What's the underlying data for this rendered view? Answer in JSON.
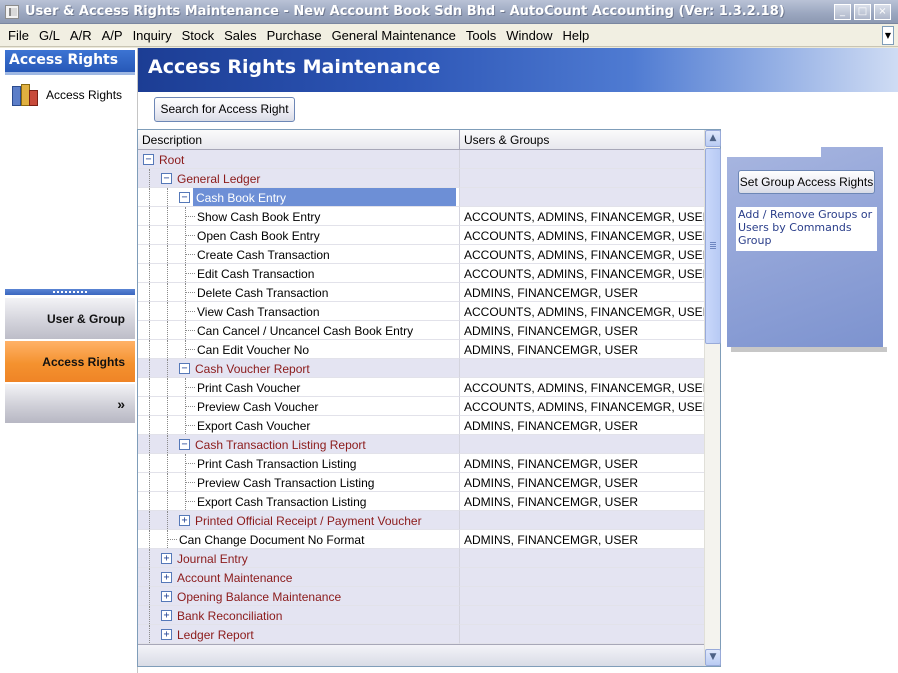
{
  "window": {
    "title": "User & Access Rights Maintenance - New Account Book Sdn Bhd - AutoCount Accounting (Ver: 1.3.2.18)",
    "min_glyph": "_",
    "max_glyph": "□",
    "close_glyph": "×"
  },
  "menu": [
    "File",
    "G/L",
    "A/R",
    "A/P",
    "Inquiry",
    "Stock",
    "Sales",
    "Purchase",
    "General Maintenance",
    "Tools",
    "Window",
    "Help"
  ],
  "leftnav": {
    "header": "Access Rights",
    "item_label": "Access Rights",
    "user_group_button": "User & Group",
    "access_rights_button": "Access Rights",
    "more_button": "»"
  },
  "header": {
    "title": "Access Rights Maintenance"
  },
  "search_button": "Search for Access Right",
  "tree": {
    "col_description": "Description",
    "col_users": "Users & Groups",
    "rows": [
      {
        "label": "Root",
        "users": "",
        "group": true
      },
      {
        "label": "General Ledger",
        "users": "",
        "group": true
      },
      {
        "label": "Cash Book Entry",
        "users": "",
        "group": true,
        "selected": true
      },
      {
        "label": "Show Cash Book Entry",
        "users": "ACCOUNTS, ADMINS, FINANCEMGR, USER"
      },
      {
        "label": "Open Cash Book Entry",
        "users": "ACCOUNTS, ADMINS, FINANCEMGR, USER"
      },
      {
        "label": "Create Cash Transaction",
        "users": "ACCOUNTS, ADMINS, FINANCEMGR, USER"
      },
      {
        "label": "Edit Cash Transaction",
        "users": "ACCOUNTS, ADMINS, FINANCEMGR, USER"
      },
      {
        "label": "Delete Cash Transaction",
        "users": "ADMINS, FINANCEMGR, USER"
      },
      {
        "label": "View Cash Transaction",
        "users": "ACCOUNTS, ADMINS, FINANCEMGR, USER"
      },
      {
        "label": "Can Cancel / Uncancel Cash Book Entry",
        "users": "ADMINS, FINANCEMGR, USER"
      },
      {
        "label": "Can Edit Voucher No",
        "users": "ADMINS, FINANCEMGR, USER"
      },
      {
        "label": "Cash Voucher Report",
        "users": "",
        "group": true
      },
      {
        "label": "Print Cash Voucher",
        "users": "ACCOUNTS, ADMINS, FINANCEMGR, USER"
      },
      {
        "label": "Preview Cash Voucher",
        "users": "ACCOUNTS, ADMINS, FINANCEMGR, USER"
      },
      {
        "label": "Export Cash Voucher",
        "users": "ADMINS, FINANCEMGR, USER"
      },
      {
        "label": "Cash Transaction Listing Report",
        "users": "",
        "group": true
      },
      {
        "label": "Print Cash Transaction Listing",
        "users": "ADMINS, FINANCEMGR, USER"
      },
      {
        "label": "Preview Cash Transaction Listing",
        "users": "ADMINS, FINANCEMGR, USER"
      },
      {
        "label": "Export Cash Transaction Listing",
        "users": "ADMINS, FINANCEMGR, USER"
      },
      {
        "label": "Printed Official Receipt / Payment Voucher",
        "users": "",
        "group": true,
        "collapsed": true
      },
      {
        "label": "Can Change Document No Format",
        "users": "ADMINS, FINANCEMGR, USER"
      },
      {
        "label": "Journal Entry",
        "users": "",
        "group": true,
        "collapsed": true
      },
      {
        "label": "Account Maintenance",
        "users": "",
        "group": true,
        "collapsed": true
      },
      {
        "label": "Opening Balance Maintenance",
        "users": "",
        "group": true,
        "collapsed": true
      },
      {
        "label": "Bank Reconciliation",
        "users": "",
        "group": true,
        "collapsed": true
      },
      {
        "label": "Ledger Report",
        "users": "",
        "group": true,
        "collapsed": true
      }
    ]
  },
  "right_panel": {
    "button": "Set Group Access Rights",
    "link": "Add / Remove Groups or Users by Commands Group"
  }
}
